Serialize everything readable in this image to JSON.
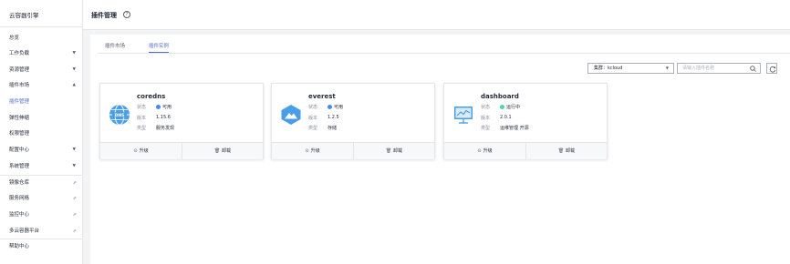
{
  "sidebar": {
    "title": "云容器引擎",
    "items": [
      {
        "label": "总览",
        "arrow": false,
        "pin": false,
        "active": false
      },
      {
        "label": "工作负载",
        "arrow": true,
        "pin": false,
        "active": false
      },
      {
        "label": "资源管理",
        "arrow": true,
        "pin": false,
        "active": false
      },
      {
        "label": "插件市场",
        "arrow": true,
        "pin": false,
        "active": false
      },
      {
        "label": "插件管理",
        "arrow": false,
        "pin": false,
        "active": true
      },
      {
        "label": "弹性伸缩",
        "arrow": false,
        "pin": false,
        "active": false
      },
      {
        "label": "权限管理",
        "arrow": false,
        "pin": false,
        "active": false
      },
      {
        "label": "配置中心",
        "arrow": true,
        "pin": false,
        "active": false
      },
      {
        "label": "系统管理",
        "arrow": true,
        "pin": false,
        "active": false
      },
      {
        "label": "镜像仓库",
        "arrow": false,
        "pin": true,
        "active": false
      },
      {
        "label": "服务网格",
        "arrow": false,
        "pin": true,
        "active": false
      },
      {
        "label": "监控中心",
        "arrow": false,
        "pin": true,
        "active": false
      },
      {
        "label": "多云容器平台",
        "arrow": false,
        "pin": true,
        "active": false
      },
      {
        "label": "帮助中心",
        "arrow": false,
        "pin": false,
        "active": false
      }
    ]
  },
  "header": {
    "title": "插件管理",
    "help_glyph": "?"
  },
  "tabs": [
    {
      "label": "插件市场",
      "active": false
    },
    {
      "label": "插件实例",
      "active": true
    }
  ],
  "toolbar": {
    "cluster_label": "集群：kcloud",
    "caret": "▼",
    "search_placeholder": "请输入插件名称"
  },
  "field_labels": {
    "status": "状态",
    "version": "版本",
    "type": "类型"
  },
  "actions": {
    "upgrade": "升级",
    "uninstall": "卸载",
    "upgrade_glyph": "⊙",
    "uninstall_glyph": "🗑"
  },
  "cards": [
    {
      "name": "coredns",
      "icon": "dns-globe-icon",
      "status": "可用",
      "status_color": "#3f8cf3",
      "version": "1.15.6",
      "type": "服务发现"
    },
    {
      "name": "everest",
      "icon": "mountain-cube-icon",
      "status": "可用",
      "status_color": "#3f8cf3",
      "version": "1.2.5",
      "type": "存储"
    },
    {
      "name": "dashboard",
      "icon": "dashboard-chart-icon",
      "status": "运行中",
      "status_color": "#50d4ab",
      "version": "2.0.1",
      "type": "运维管理  开源"
    }
  ],
  "colors": {
    "accent": "#526ecc",
    "icon_blue": "#4a9ee8"
  }
}
